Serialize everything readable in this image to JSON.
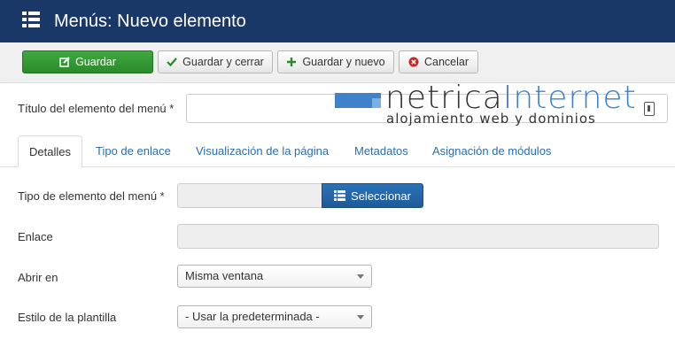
{
  "header": {
    "title": "Menús: Nuevo elemento",
    "icon": "list-icon"
  },
  "toolbar": {
    "save_label": "Guardar",
    "save_close_label": "Guardar y cerrar",
    "save_new_label": "Guardar y nuevo",
    "cancel_label": "Cancelar"
  },
  "form": {
    "title_label": "Título del elemento del menú *",
    "title_value": "",
    "type_label": "Tipo de elemento del menú *",
    "select_label": "Seleccionar",
    "link_label": "Enlace",
    "open_label": "Abrir en",
    "open_value": "Misma ventana",
    "template_label": "Estilo de la plantilla",
    "template_value": "- Usar la predeterminada -"
  },
  "tabs": [
    "Detalles",
    "Tipo de enlace",
    "Visualización de la página",
    "Metadatos",
    "Asignación de módulos"
  ],
  "watermark": {
    "brand_a": "netrica",
    "brand_b": "Internet",
    "tagline": "alojamiento web y dominios"
  },
  "colors": {
    "header_bg": "#1a3867",
    "save_green": "#2b8a2b",
    "select_blue": "#1f5a98",
    "link_blue": "#2a6db0",
    "brand_blue": "#3f82c9"
  }
}
